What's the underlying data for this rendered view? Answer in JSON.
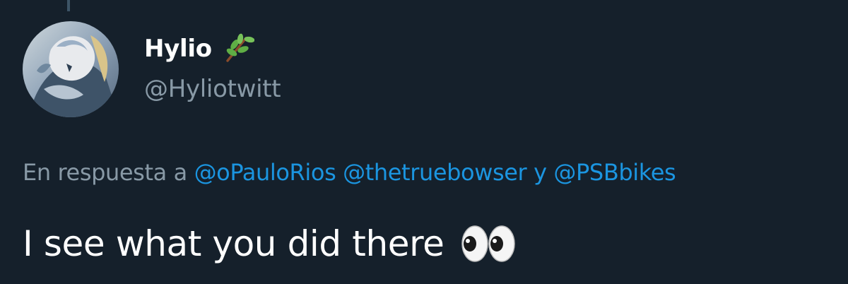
{
  "tweet": {
    "author": {
      "display_name": "Hylio",
      "name_badge_icon": "herb-icon",
      "handle": "@Hyliotwitt",
      "avatar": "avatar"
    },
    "reply_context": {
      "prefix": "En respuesta a",
      "mentions": [
        "@oPauloRios",
        "@thetruebowser",
        "@PSBbikes"
      ],
      "separator": "y"
    },
    "text": "I see what you did there",
    "trailing_emoji_icon": "eyes-icon"
  },
  "colors": {
    "background": "#15202b",
    "primary_text": "#ffffff",
    "secondary_text": "#8899a6",
    "link": "#1b95e0"
  }
}
